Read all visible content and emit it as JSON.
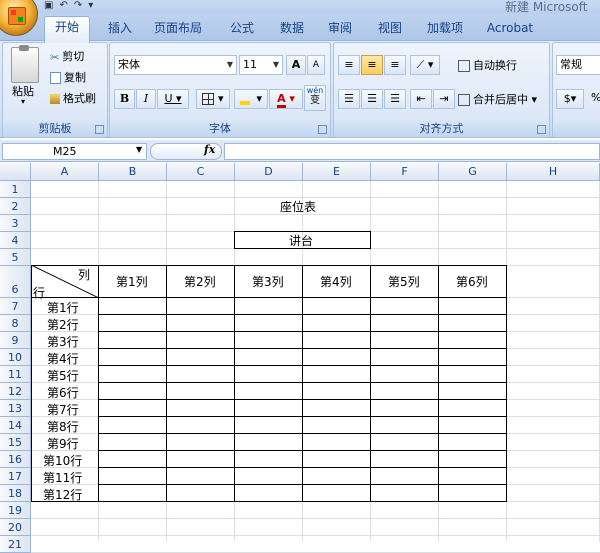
{
  "window": {
    "title": "新建 Microsoft"
  },
  "quick_access": {
    "save_glyph": "▣",
    "undo_glyph": "↶",
    "redo_glyph": "↷",
    "more_glyph": "▾"
  },
  "tabs": [
    {
      "label": "开始",
      "active": true
    },
    {
      "label": "插入"
    },
    {
      "label": "页面布局"
    },
    {
      "label": "公式"
    },
    {
      "label": "数据"
    },
    {
      "label": "审阅"
    },
    {
      "label": "视图"
    },
    {
      "label": "加载项"
    },
    {
      "label": "Acrobat"
    }
  ],
  "clipboard": {
    "paste_label": "粘贴",
    "cut_label": "剪切",
    "copy_label": "复制",
    "format_painter_label": "格式刷",
    "group_label": "剪贴板"
  },
  "font": {
    "font_name": "宋体",
    "font_size": "11",
    "bold": "B",
    "italic": "I",
    "underline": "U",
    "grow": "A",
    "shrink": "A",
    "font_color": "A",
    "phonetic": "wén",
    "phonetic_char": "变",
    "group_label": "字体"
  },
  "alignment": {
    "wrap_label": "自动换行",
    "merge_label": "合并后居中",
    "group_label": "对齐方式"
  },
  "number": {
    "format": "常规",
    "percent": "%"
  },
  "formula_bar": {
    "name_box": "M25",
    "fx": "fx",
    "value": ""
  },
  "colors": {
    "ribbon_text": "#15428b",
    "tab_active_border": "#8db2e3",
    "highlight": "#fbcd5b"
  },
  "columns": [
    "A",
    "B",
    "C",
    "D",
    "E",
    "F",
    "G",
    "H"
  ],
  "rows": [
    "1",
    "2",
    "3",
    "4",
    "5",
    "6",
    "7",
    "8",
    "9",
    "10",
    "11",
    "12",
    "13",
    "14",
    "15",
    "16",
    "17",
    "18",
    "19",
    "20",
    "21"
  ],
  "sheet": {
    "title": "座位表",
    "podium": "讲台",
    "corner_col_label": "列",
    "corner_row_label": "行",
    "col_headers": [
      "第1列",
      "第2列",
      "第3列",
      "第4列",
      "第5列",
      "第6列"
    ],
    "row_headers": [
      "第1行",
      "第2行",
      "第3行",
      "第4行",
      "第5行",
      "第6行",
      "第7行",
      "第8行",
      "第9行",
      "第10行",
      "第11行",
      "第12行"
    ]
  }
}
